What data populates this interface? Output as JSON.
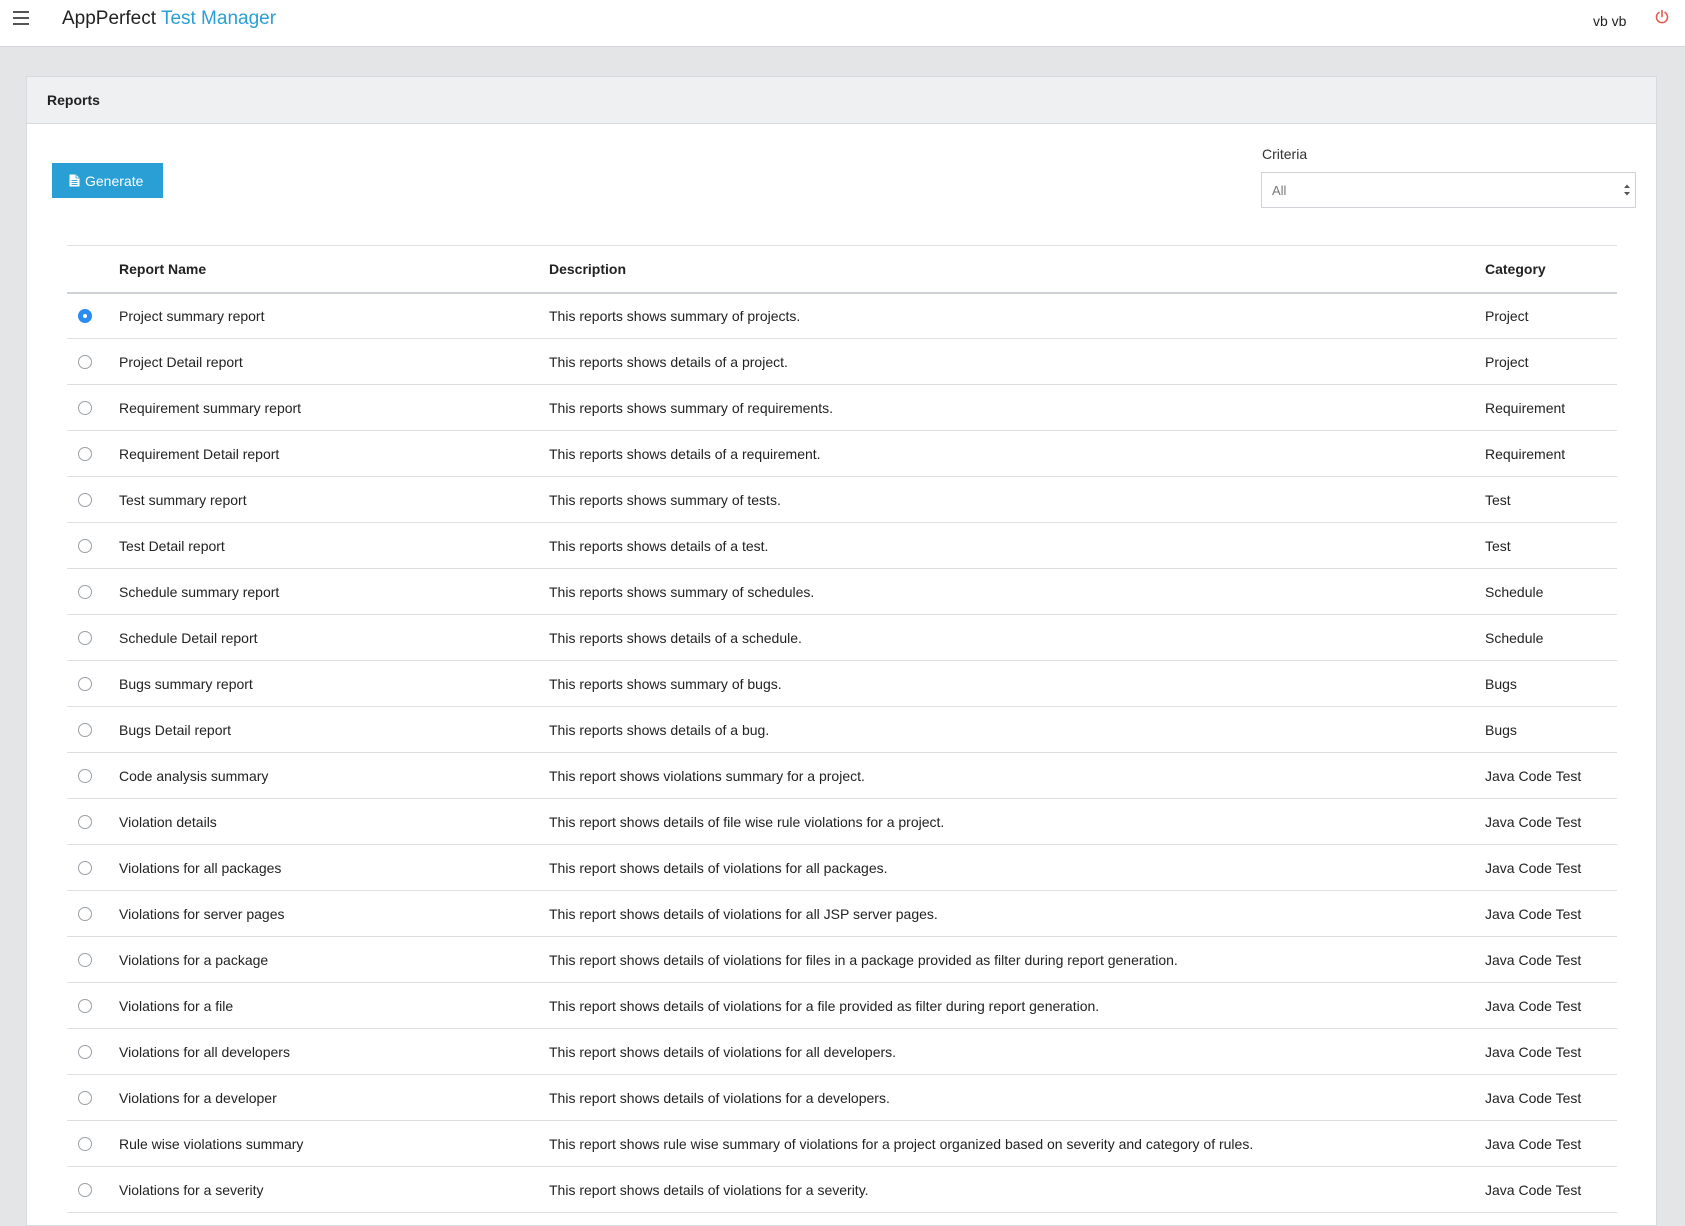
{
  "header": {
    "brand_main": "AppPerfect",
    "brand_accent": "Test Manager",
    "user": "vb vb"
  },
  "panel": {
    "title": "Reports",
    "generate_label": "Generate",
    "criteria_label": "Criteria",
    "criteria_value": "All"
  },
  "colors": {
    "accent": "#2a9fd6",
    "power": "#e05a4f",
    "radio_checked": "#2a8cf0"
  },
  "table": {
    "headers": {
      "name": "Report Name",
      "description": "Description",
      "category": "Category"
    },
    "rows": [
      {
        "name": "Project summary report",
        "description": "This reports shows summary of projects.",
        "category": "Project",
        "selected": true
      },
      {
        "name": "Project Detail report",
        "description": "This reports shows details of a project.",
        "category": "Project",
        "selected": false
      },
      {
        "name": "Requirement summary report",
        "description": "This reports shows summary of requirements.",
        "category": "Requirement",
        "selected": false
      },
      {
        "name": "Requirement Detail report",
        "description": "This reports shows details of a requirement.",
        "category": "Requirement",
        "selected": false
      },
      {
        "name": "Test summary report",
        "description": "This reports shows summary of tests.",
        "category": "Test",
        "selected": false
      },
      {
        "name": "Test Detail report",
        "description": "This reports shows details of a test.",
        "category": "Test",
        "selected": false
      },
      {
        "name": "Schedule summary report",
        "description": "This reports shows summary of schedules.",
        "category": "Schedule",
        "selected": false
      },
      {
        "name": "Schedule Detail report",
        "description": "This reports shows details of a schedule.",
        "category": "Schedule",
        "selected": false
      },
      {
        "name": "Bugs summary report",
        "description": "This reports shows summary of bugs.",
        "category": "Bugs",
        "selected": false
      },
      {
        "name": "Bugs Detail report",
        "description": "This reports shows details of a bug.",
        "category": "Bugs",
        "selected": false
      },
      {
        "name": "Code analysis summary",
        "description": "This report shows violations summary for a project.",
        "category": "Java Code Test",
        "selected": false
      },
      {
        "name": "Violation details",
        "description": "This report shows details of file wise rule violations for a project.",
        "category": "Java Code Test",
        "selected": false
      },
      {
        "name": "Violations for all packages",
        "description": "This report shows details of violations for all packages.",
        "category": "Java Code Test",
        "selected": false
      },
      {
        "name": "Violations for server pages",
        "description": "This report shows details of violations for all JSP server pages.",
        "category": "Java Code Test",
        "selected": false
      },
      {
        "name": "Violations for a package",
        "description": "This report shows details of violations for files in a package provided as filter during report generation.",
        "category": "Java Code Test",
        "selected": false
      },
      {
        "name": "Violations for a file",
        "description": "This report shows details of violations for a file provided as filter during report generation.",
        "category": "Java Code Test",
        "selected": false
      },
      {
        "name": "Violations for all developers",
        "description": "This report shows details of violations for all developers.",
        "category": "Java Code Test",
        "selected": false
      },
      {
        "name": "Violations for a developer",
        "description": "This report shows details of violations for a developers.",
        "category": "Java Code Test",
        "selected": false
      },
      {
        "name": "Rule wise violations summary",
        "description": "This report shows rule wise summary of violations for a project organized based on severity and category of rules.",
        "category": "Java Code Test",
        "selected": false
      },
      {
        "name": "Violations for a severity",
        "description": "This report shows details of violations for a severity.",
        "category": "Java Code Test",
        "selected": false
      }
    ]
  }
}
